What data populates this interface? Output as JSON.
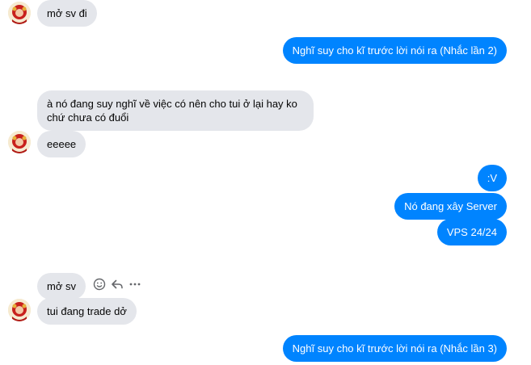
{
  "contact": {
    "avatar_icon": "contact-avatar"
  },
  "messages": [
    {
      "direction": "in",
      "text": "mở sv đi"
    },
    {
      "direction": "out",
      "text": "Nghĩ suy cho kĩ trước lời nói ra (Nhắc lần 2)"
    },
    {
      "direction": "in",
      "text": "à nó đang suy nghĩ về việc có nên cho tui ở lại hay ko chứ chưa có đuổi"
    },
    {
      "direction": "in",
      "text": "eeeee"
    },
    {
      "direction": "out",
      "text": ":V"
    },
    {
      "direction": "out",
      "text": "Nó đang xây Server"
    },
    {
      "direction": "out",
      "text": "VPS 24/24"
    },
    {
      "direction": "in",
      "text": "mở sv"
    },
    {
      "direction": "in",
      "text": "tui đang trade dở"
    },
    {
      "direction": "out",
      "text": "Nghĩ suy cho kĩ trước lời nói ra (Nhắc lần 3)"
    }
  ],
  "message_actions": {
    "react_icon": "smile-icon",
    "reply_icon": "reply-icon",
    "more_icon": "more-icon"
  },
  "colors": {
    "outgoing_bubble": "#0084ff",
    "incoming_bubble": "#e4e6eb",
    "icon_gray": "#65676b"
  }
}
